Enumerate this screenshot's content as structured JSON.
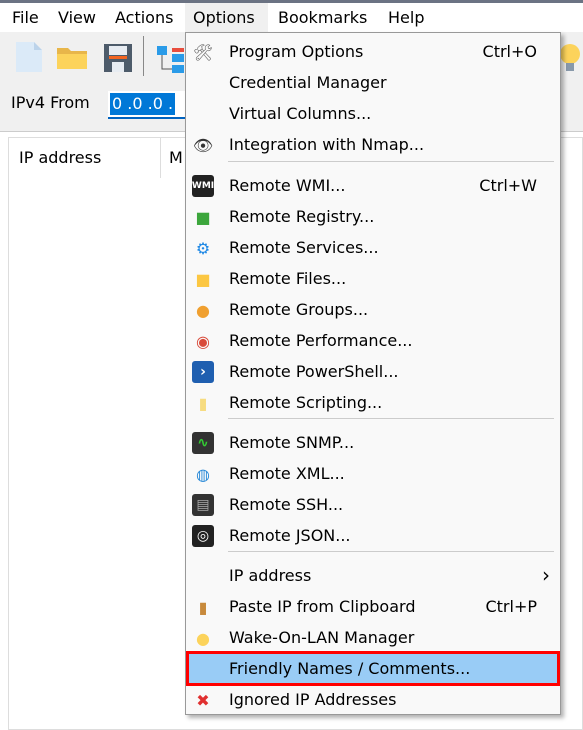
{
  "menubar": [
    "File",
    "View",
    "Actions",
    "Options",
    "Bookmarks",
    "Help"
  ],
  "ip": {
    "label": "IPv4 From",
    "value": "0 .0 .0 ."
  },
  "list": {
    "columns": [
      "IP address",
      "M"
    ]
  },
  "options_menu": {
    "items": [
      {
        "label": "Program Options",
        "shortcut": "Ctrl+O",
        "icon": "tools-icon"
      },
      {
        "label": "Credential Manager",
        "shortcut": "",
        "icon": ""
      },
      {
        "label": "Virtual Columns...",
        "shortcut": "",
        "icon": ""
      },
      {
        "label": "Integration with Nmap...",
        "shortcut": "",
        "icon": "eye-icon"
      },
      {
        "label": "Remote WMI...",
        "shortcut": "Ctrl+W",
        "icon": "wmi-icon"
      },
      {
        "label": "Remote Registry...",
        "shortcut": "",
        "icon": "registry-icon"
      },
      {
        "label": "Remote Services...",
        "shortcut": "",
        "icon": "gear-icon"
      },
      {
        "label": "Remote Files...",
        "shortcut": "",
        "icon": "folder-icon"
      },
      {
        "label": "Remote Groups...",
        "shortcut": "",
        "icon": "users-icon"
      },
      {
        "label": "Remote Performance...",
        "shortcut": "",
        "icon": "gauge-icon"
      },
      {
        "label": "Remote PowerShell...",
        "shortcut": "",
        "icon": "powershell-icon"
      },
      {
        "label": "Remote Scripting...",
        "shortcut": "",
        "icon": "scroll-icon"
      },
      {
        "label": "Remote SNMP...",
        "shortcut": "",
        "icon": "snmp-icon"
      },
      {
        "label": "Remote XML...",
        "shortcut": "",
        "icon": "xml-globe-icon"
      },
      {
        "label": "Remote SSH...",
        "shortcut": "",
        "icon": "terminal-icon"
      },
      {
        "label": "Remote JSON...",
        "shortcut": "",
        "icon": "json-icon"
      },
      {
        "label": "IP address",
        "shortcut": "›",
        "icon": ""
      },
      {
        "label": "Paste IP from Clipboard",
        "shortcut": "Ctrl+P",
        "icon": "clipboard-icon"
      },
      {
        "label": "Wake-On-LAN Manager",
        "shortcut": "",
        "icon": "lightbulb-icon"
      },
      {
        "label": "Friendly Names / Comments...",
        "shortcut": "",
        "icon": ""
      },
      {
        "label": "Ignored IP Addresses",
        "shortcut": "",
        "icon": "red-x-icon"
      }
    ],
    "highlighted_index": 19,
    "highlight_color": "#99ccf6",
    "annotation_color": "#ff0000"
  }
}
